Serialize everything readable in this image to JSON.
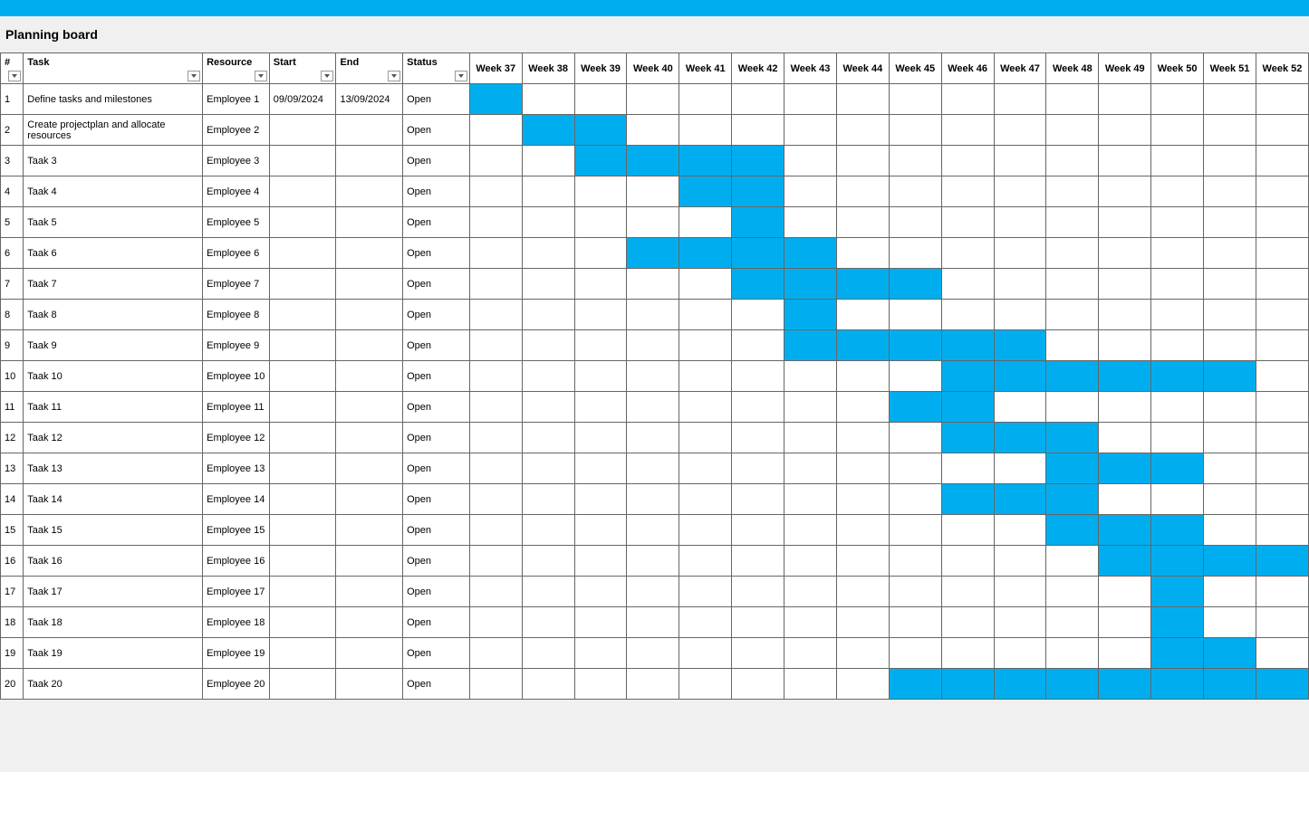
{
  "title": "Planning board",
  "columns": {
    "num": "#",
    "task": "Task",
    "resource": "Resource",
    "start": "Start",
    "end": "End",
    "status": "Status"
  },
  "weeks": [
    "Week 37",
    "Week 38",
    "Week 39",
    "Week 40",
    "Week 41",
    "Week 42",
    "Week 43",
    "Week 44",
    "Week 45",
    "Week 46",
    "Week 47",
    "Week 48",
    "Week 49",
    "Week 50",
    "Week 51",
    "Week 52"
  ],
  "rows": [
    {
      "num": "1",
      "task": "Define tasks and milestones",
      "resource": "Employee 1",
      "start": "09/09/2024",
      "end": "13/09/2024",
      "status": "Open",
      "bars": [
        1,
        0,
        0,
        0,
        0,
        0,
        0,
        0,
        0,
        0,
        0,
        0,
        0,
        0,
        0,
        0
      ]
    },
    {
      "num": "2",
      "task": "Create projectplan and allocate resources",
      "resource": "Employee 2",
      "start": "",
      "end": "",
      "status": "Open",
      "bars": [
        0,
        1,
        1,
        0,
        0,
        0,
        0,
        0,
        0,
        0,
        0,
        0,
        0,
        0,
        0,
        0
      ]
    },
    {
      "num": "3",
      "task": "Taak 3",
      "resource": "Employee 3",
      "start": "",
      "end": "",
      "status": "Open",
      "bars": [
        0,
        0,
        1,
        1,
        1,
        1,
        0,
        0,
        0,
        0,
        0,
        0,
        0,
        0,
        0,
        0
      ]
    },
    {
      "num": "4",
      "task": "Taak 4",
      "resource": "Employee 4",
      "start": "",
      "end": "",
      "status": "Open",
      "bars": [
        0,
        0,
        0,
        0,
        1,
        1,
        0,
        0,
        0,
        0,
        0,
        0,
        0,
        0,
        0,
        0
      ]
    },
    {
      "num": "5",
      "task": "Taak 5",
      "resource": "Employee 5",
      "start": "",
      "end": "",
      "status": "Open",
      "bars": [
        0,
        0,
        0,
        0,
        0,
        1,
        0,
        0,
        0,
        0,
        0,
        0,
        0,
        0,
        0,
        0
      ]
    },
    {
      "num": "6",
      "task": "Taak 6",
      "resource": "Employee 6",
      "start": "",
      "end": "",
      "status": "Open",
      "bars": [
        0,
        0,
        0,
        1,
        1,
        1,
        1,
        0,
        0,
        0,
        0,
        0,
        0,
        0,
        0,
        0
      ]
    },
    {
      "num": "7",
      "task": "Taak 7",
      "resource": "Employee 7",
      "start": "",
      "end": "",
      "status": "Open",
      "bars": [
        0,
        0,
        0,
        0,
        0,
        1,
        1,
        1,
        1,
        0,
        0,
        0,
        0,
        0,
        0,
        0
      ]
    },
    {
      "num": "8",
      "task": "Taak 8",
      "resource": "Employee 8",
      "start": "",
      "end": "",
      "status": "Open",
      "bars": [
        0,
        0,
        0,
        0,
        0,
        0,
        1,
        0,
        0,
        0,
        0,
        0,
        0,
        0,
        0,
        0
      ]
    },
    {
      "num": "9",
      "task": "Taak 9",
      "resource": "Employee 9",
      "start": "",
      "end": "",
      "status": "Open",
      "bars": [
        0,
        0,
        0,
        0,
        0,
        0,
        1,
        1,
        1,
        1,
        1,
        0,
        0,
        0,
        0,
        0
      ]
    },
    {
      "num": "10",
      "task": "Taak 10",
      "resource": "Employee 10",
      "start": "",
      "end": "",
      "status": "Open",
      "bars": [
        0,
        0,
        0,
        0,
        0,
        0,
        0,
        0,
        0,
        1,
        1,
        1,
        1,
        1,
        1,
        0
      ]
    },
    {
      "num": "11",
      "task": "Taak 11",
      "resource": "Employee 11",
      "start": "",
      "end": "",
      "status": "Open",
      "bars": [
        0,
        0,
        0,
        0,
        0,
        0,
        0,
        0,
        1,
        1,
        0,
        0,
        0,
        0,
        0,
        0
      ]
    },
    {
      "num": "12",
      "task": "Taak 12",
      "resource": "Employee 12",
      "start": "",
      "end": "",
      "status": "Open",
      "bars": [
        0,
        0,
        0,
        0,
        0,
        0,
        0,
        0,
        0,
        1,
        1,
        1,
        0,
        0,
        0,
        0
      ]
    },
    {
      "num": "13",
      "task": "Taak 13",
      "resource": "Employee 13",
      "start": "",
      "end": "",
      "status": "Open",
      "bars": [
        0,
        0,
        0,
        0,
        0,
        0,
        0,
        0,
        0,
        0,
        0,
        1,
        1,
        1,
        0,
        0
      ]
    },
    {
      "num": "14",
      "task": "Taak 14",
      "resource": "Employee 14",
      "start": "",
      "end": "",
      "status": "Open",
      "bars": [
        0,
        0,
        0,
        0,
        0,
        0,
        0,
        0,
        0,
        1,
        1,
        1,
        0,
        0,
        0,
        0
      ]
    },
    {
      "num": "15",
      "task": "Taak 15",
      "resource": "Employee 15",
      "start": "",
      "end": "",
      "status": "Open",
      "bars": [
        0,
        0,
        0,
        0,
        0,
        0,
        0,
        0,
        0,
        0,
        0,
        1,
        1,
        1,
        0,
        0
      ]
    },
    {
      "num": "16",
      "task": "Taak 16",
      "resource": "Employee 16",
      "start": "",
      "end": "",
      "status": "Open",
      "bars": [
        0,
        0,
        0,
        0,
        0,
        0,
        0,
        0,
        0,
        0,
        0,
        0,
        1,
        1,
        1,
        1
      ]
    },
    {
      "num": "17",
      "task": "Taak 17",
      "resource": "Employee 17",
      "start": "",
      "end": "",
      "status": "Open",
      "bars": [
        0,
        0,
        0,
        0,
        0,
        0,
        0,
        0,
        0,
        0,
        0,
        0,
        0,
        1,
        0,
        0
      ]
    },
    {
      "num": "18",
      "task": "Taak 18",
      "resource": "Employee 18",
      "start": "",
      "end": "",
      "status": "Open",
      "bars": [
        0,
        0,
        0,
        0,
        0,
        0,
        0,
        0,
        0,
        0,
        0,
        0,
        0,
        1,
        0,
        0
      ]
    },
    {
      "num": "19",
      "task": "Taak 19",
      "resource": "Employee 19",
      "start": "",
      "end": "",
      "status": "Open",
      "bars": [
        0,
        0,
        0,
        0,
        0,
        0,
        0,
        0,
        0,
        0,
        0,
        0,
        0,
        1,
        1,
        0
      ]
    },
    {
      "num": "20",
      "task": "Taak 20",
      "resource": "Employee 20",
      "start": "",
      "end": "",
      "status": "Open",
      "bars": [
        0,
        0,
        0,
        0,
        0,
        0,
        0,
        0,
        1,
        1,
        1,
        1,
        1,
        1,
        1,
        1
      ]
    }
  ]
}
